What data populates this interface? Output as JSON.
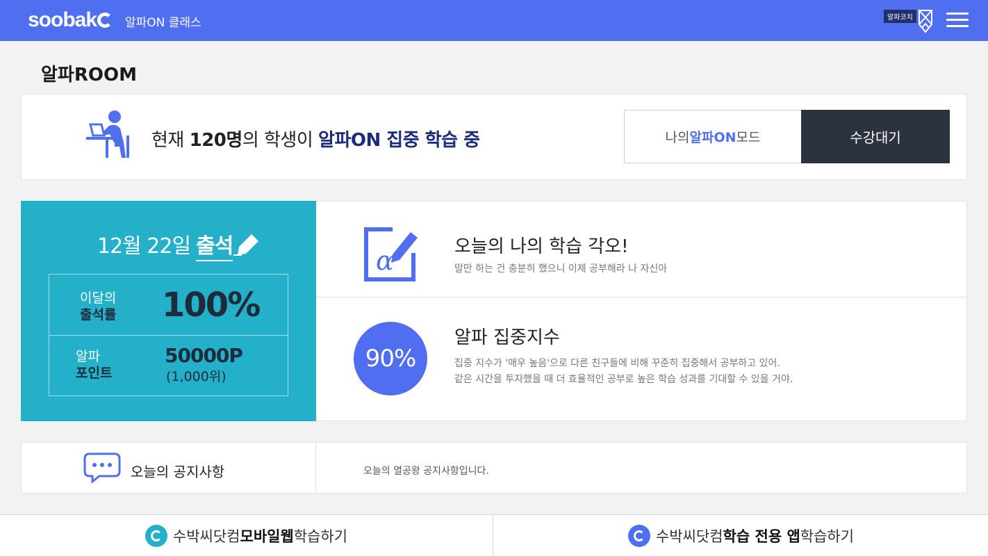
{
  "header": {
    "logo": "soobak",
    "app_name": "알파ON 클래스",
    "coach_badge": "알파코치",
    "accent_color": "#4f6ef0"
  },
  "page_title": "알파ROOM",
  "status_card": {
    "headline_prefix": "현재 ",
    "student_count": "120명",
    "headline_mid": "의 학생이 ",
    "headline_emph": "알파ON 집중 학습 중",
    "mode_prefix": "나의 ",
    "mode_emph": "알파ON",
    "mode_suffix": " 모드",
    "mode_button": "수강대기"
  },
  "attendance": {
    "date": "12월 22일",
    "word": "출석",
    "rate_label_1": "이달의",
    "rate_label_2": "출석률",
    "rate_value": "100%",
    "point_label_1": "알파",
    "point_label_2": "포인트",
    "point_value": "50000P",
    "point_rank": "(1,000위)",
    "panel_color": "#25b0ca"
  },
  "resolution": {
    "title": "오늘의 나의 학습 각오!",
    "desc": "말만 하는 건 충분히 했으니 이제 공부해라 나 자신아"
  },
  "focus": {
    "title": "알파 집중지수",
    "value": "90%",
    "desc_1": "집중 지수가 '매우 높음'으로 다른 친구들에 비해 꾸준히 집중해서 공부하고 있어.",
    "desc_2": "같은 시간을 투자했을 때 더 효율적인 공부로 높은 학습 성과를 기대할 수 있을 거야."
  },
  "notice": {
    "label": "오늘의 공지사항",
    "text": "오늘의 열공왕 공지사항입니다."
  },
  "bottom": {
    "left_prefix": "수박씨닷컴 ",
    "left_emph": "모바일웹",
    "left_suffix": " 학습하기",
    "right_prefix": "수박씨닷컴 ",
    "right_emph": "학습 전용 앱",
    "right_suffix": " 학습하기"
  }
}
